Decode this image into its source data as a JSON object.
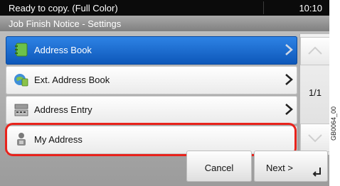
{
  "status": {
    "message": "Ready to copy. (Full Color)",
    "time": "10:10"
  },
  "title": "Job Finish Notice - Settings",
  "list": {
    "items": [
      {
        "label": "Address Book",
        "icon": "address-book-icon",
        "selected": true
      },
      {
        "label": "Ext. Address Book",
        "icon": "ext-address-book-icon",
        "selected": false
      },
      {
        "label": "Address Entry",
        "icon": "keyboard-icon",
        "selected": false
      },
      {
        "label": "My Address",
        "icon": "user-icon",
        "selected": false
      }
    ],
    "page_indicator": "1/1"
  },
  "buttons": {
    "cancel": "Cancel",
    "next": "Next >"
  },
  "side_code": "GB0064_00",
  "colors": {
    "selected_row": "#0c56b8",
    "highlight": "#e8231c"
  }
}
